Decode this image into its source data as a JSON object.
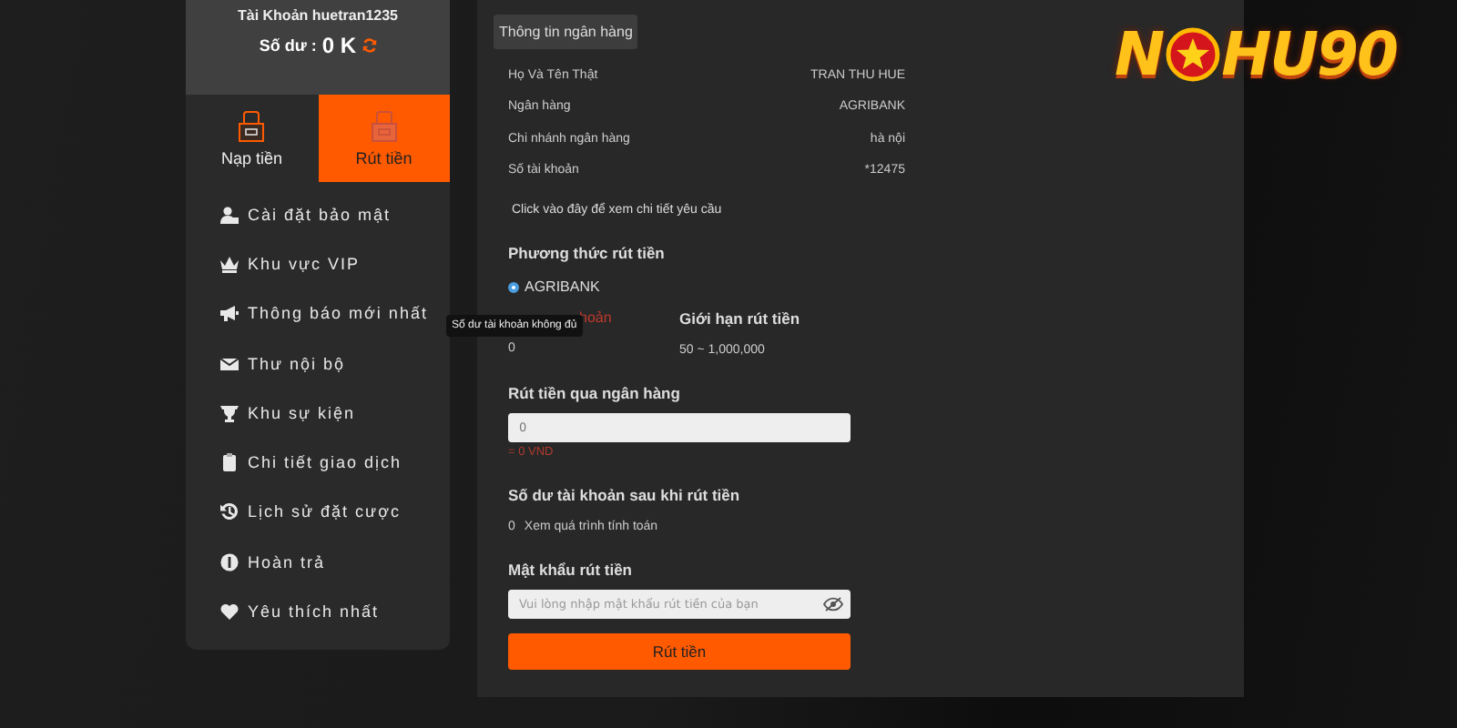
{
  "account": {
    "username_line": "Tài Khoản huetran1235",
    "balance_label": "Số dư :",
    "balance": "0 K"
  },
  "wallet_tabs": [
    {
      "label": "Nạp tiền",
      "selected": false
    },
    {
      "label": "Rút tiền",
      "selected": true
    }
  ],
  "menu": [
    {
      "label": "Cài đặt bảo mật",
      "kind": "security"
    },
    {
      "label": "Khu vực VIP",
      "kind": "vip"
    },
    {
      "label": "Thông báo mới nhất",
      "kind": "news"
    },
    {
      "label": "Thư nội bộ",
      "kind": "mail"
    },
    {
      "label": "Khu sự kiện",
      "kind": "events"
    },
    {
      "label": "Chi tiết giao dịch",
      "kind": "transactions"
    },
    {
      "label": "Lịch sử đặt cược",
      "kind": "history"
    },
    {
      "label": "Hoàn trả",
      "kind": "rebate"
    },
    {
      "label": "Yêu thích nhất",
      "kind": "favorites"
    }
  ],
  "bank_info": {
    "tab": "Thông tin ngân hàng",
    "rows": [
      {
        "label": "Họ Và Tên Thật",
        "value": "TRAN THU HUE"
      },
      {
        "label": "Ngân hàng",
        "value": "AGRIBANK"
      },
      {
        "label": "Chi nhánh ngân hàng",
        "value": "hà nội"
      },
      {
        "label": "Số tài khoản",
        "value": "*12475"
      }
    ],
    "details_link": "Click vào đây để xem chi tiết yêu cầu"
  },
  "method": {
    "heading": "Phương thức rút tiền",
    "options": [
      {
        "label": "AGRIBANK",
        "selected": true
      }
    ]
  },
  "limits": {
    "balance_label_visible": "hoản",
    "balance_value": "0",
    "limit_label": "Giới hạn rút tiền",
    "limit_value": "50 ~ 1,000,000"
  },
  "tooltip": "Số dư tài khoản không đủ",
  "amount": {
    "label": "Rút tiền qua ngân hàng",
    "value": "0",
    "converted": "= 0 VND"
  },
  "after": {
    "heading": "Số dư tài khoản sau khi rút tiền",
    "value": "0",
    "link": "Xem quá trình tính toán"
  },
  "password": {
    "label": "Mật khẩu rút tiền",
    "placeholder": "Vui lòng nhập mật khẩu rút tiền của bạn"
  },
  "submit": "Rút tiền",
  "logo": {
    "before": "N",
    "after": "HU90"
  }
}
